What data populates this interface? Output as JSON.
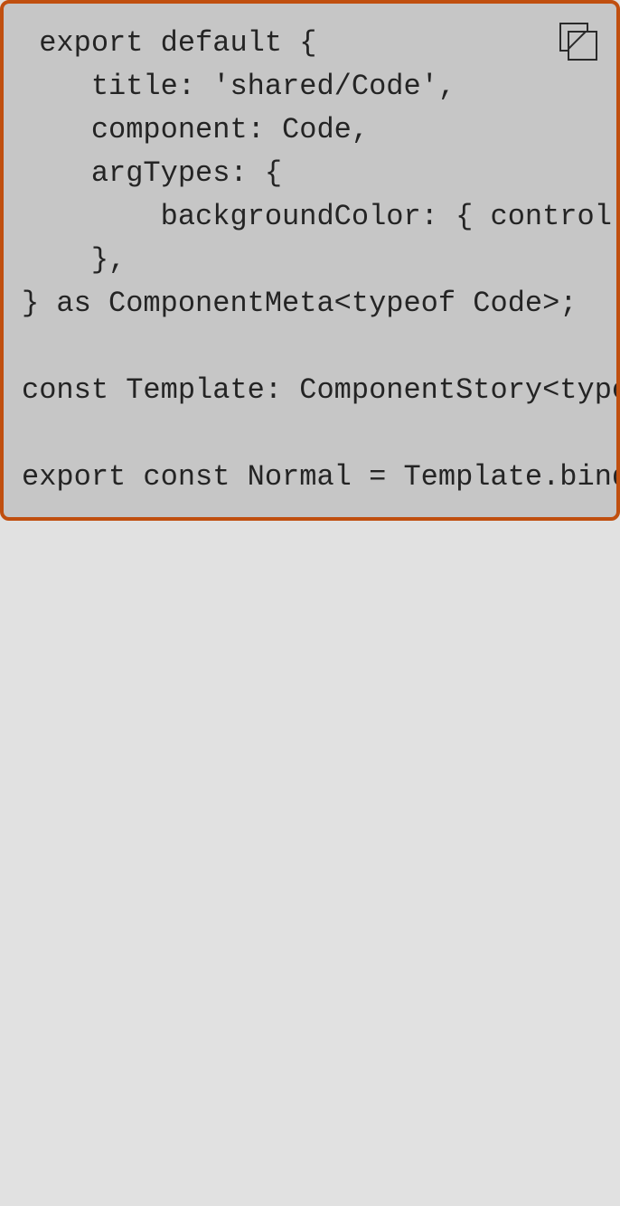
{
  "code_block": {
    "lines": [
      " export default {",
      "    title: 'shared/Code',",
      "    component: Code,",
      "    argTypes: {",
      "        backgroundColor: { control",
      "    },",
      "} as ComponentMeta<typeof Code>;",
      "",
      "const Template: ComponentStory<typeof",
      "",
      "export const Normal = Template.bind"
    ]
  },
  "copy_button": {
    "icon": "copy-icon"
  },
  "colors": {
    "page_background": "#e1e1e1",
    "panel_background": "#c6c6c6",
    "panel_border": "#c04f0f",
    "code_text": "#242424"
  }
}
